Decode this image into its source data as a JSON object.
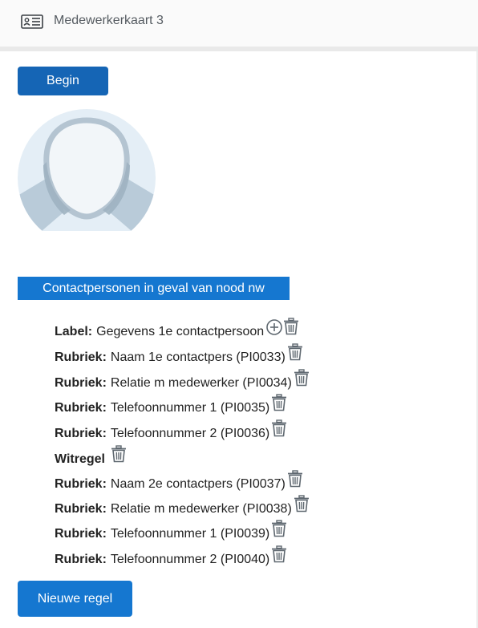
{
  "header": {
    "title": "Medewerkerkaart 3",
    "icon": "id-card-icon"
  },
  "buttons": {
    "begin_label": "Begin",
    "new_row_label": "Nieuwe regel"
  },
  "section": {
    "title": "Contactpersonen in geval van nood nw"
  },
  "rows": [
    {
      "key": "Label:",
      "text": "Gegevens 1e contactpersoon",
      "actions": [
        "add-icon",
        "trash-icon"
      ]
    },
    {
      "key": "Rubriek:",
      "text": "Naam 1e contactpers (PI0033)",
      "actions": [
        "trash-icon"
      ]
    },
    {
      "key": "Rubriek:",
      "text": "Relatie m medewerker (PI0034)",
      "actions": [
        "trash-icon"
      ]
    },
    {
      "key": "Rubriek:",
      "text": "Telefoonnummer 1 (PI0035)",
      "actions": [
        "trash-icon"
      ]
    },
    {
      "key": "Rubriek:",
      "text": "Telefoonnummer 2 (PI0036)",
      "actions": [
        "trash-icon"
      ]
    },
    {
      "key": "Witregel",
      "text": "",
      "actions": [
        "trash-icon"
      ]
    },
    {
      "key": "Rubriek:",
      "text": "Naam 2e contactpers (PI0037)",
      "actions": [
        "trash-icon"
      ]
    },
    {
      "key": "Rubriek:",
      "text": "Relatie m medewerker (PI0038)",
      "actions": [
        "trash-icon"
      ]
    },
    {
      "key": "Rubriek:",
      "text": "Telefoonnummer 1 (PI0039)",
      "actions": [
        "trash-icon"
      ]
    },
    {
      "key": "Rubriek:",
      "text": "Telefoonnummer 2 (PI0040)",
      "actions": [
        "trash-icon"
      ]
    }
  ],
  "colors": {
    "primary": "#1577d0",
    "primary_dark": "#1565b5",
    "icon_gray": "#5f6870"
  }
}
